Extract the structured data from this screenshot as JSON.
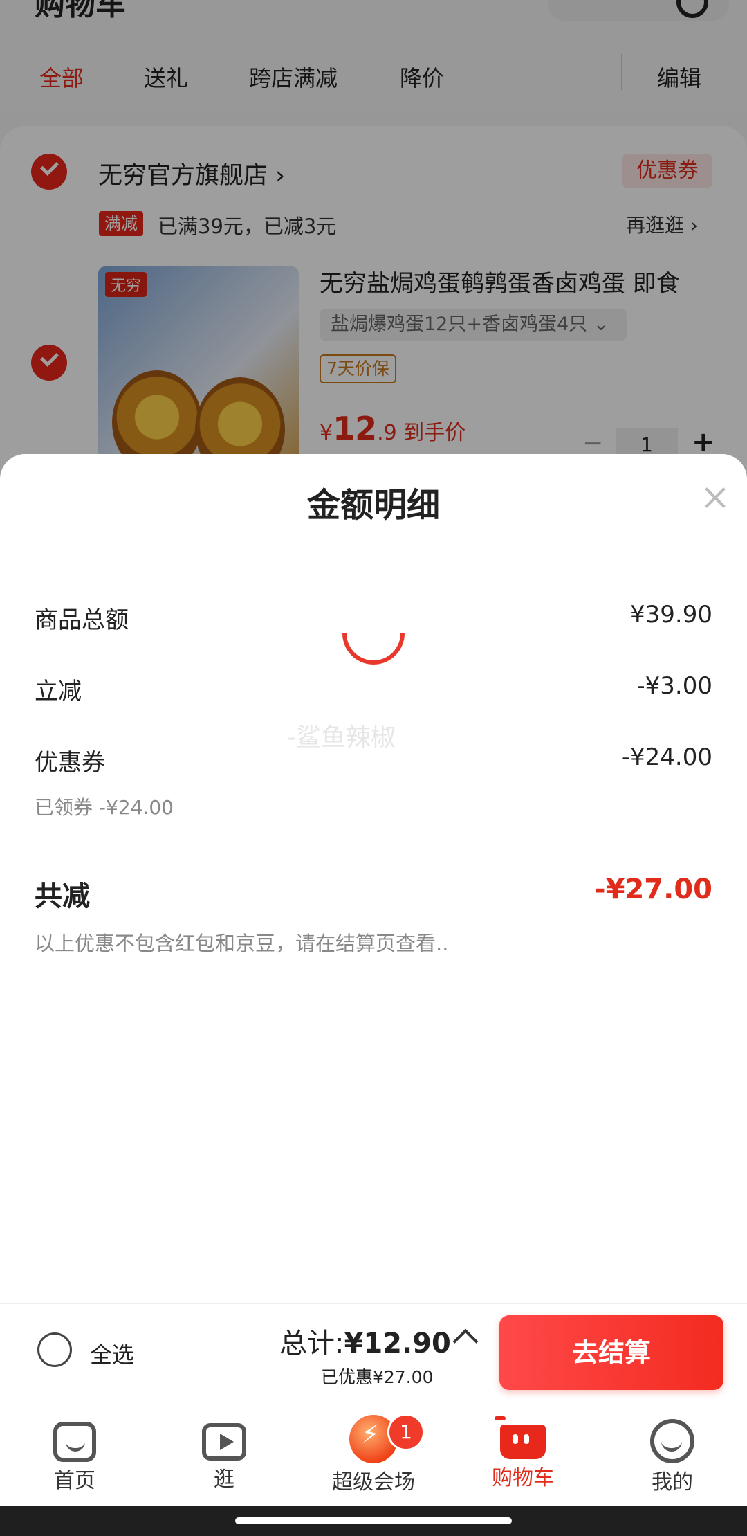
{
  "header": {
    "title": "购物车"
  },
  "tabs": [
    {
      "label": "全部"
    },
    {
      "label": "送礼"
    },
    {
      "label": "跨店满减"
    },
    {
      "label": "降价"
    }
  ],
  "edit_label": "编辑",
  "store": {
    "name": "无穷官方旗舰店 ›",
    "coupon_tag": "优惠券",
    "promo_tag": "满减",
    "promo_text": "已满39元，已减3元",
    "stroll": "再逛逛 ›",
    "brand_logo": "无穷"
  },
  "product": {
    "title": "无穷盐焗鸡蛋鹌鹑蛋香卤鸡蛋 即食",
    "sku": "盐焗爆鸡蛋12只+香卤鸡蛋4只  ⌄",
    "guarantee": "7天价保",
    "price_symbol": "¥",
    "price_int": "12",
    "price_dec": ".9",
    "price_note": "到手价",
    "qty": "1",
    "minus": "−",
    "plus": "+"
  },
  "sheet": {
    "title": "金额明细",
    "rows": [
      {
        "label": "商品总额",
        "value": "¥39.90"
      },
      {
        "label": "立减",
        "value": "-¥3.00"
      },
      {
        "label": "优惠券",
        "value": "-¥24.00"
      }
    ],
    "coupon_sub": "已领券 -¥24.00",
    "total_label": "共减",
    "total_value": "-¥27.00",
    "note": "以上优惠不包含红包和京豆，请在结算页查看..",
    "watermark": "-鲨鱼辣椒"
  },
  "checkout": {
    "select_all": "全选",
    "total_prefix": "总计:",
    "total_value": "¥12.90",
    "saved": "已优惠¥27.00",
    "pay_button": "去结算"
  },
  "nav": [
    {
      "label": "首页",
      "icon": "home-icon"
    },
    {
      "label": "逛",
      "icon": "video-icon"
    },
    {
      "label": "超级会场",
      "icon": "venue-icon"
    },
    {
      "label": "购物车",
      "icon": "cart-icon"
    },
    {
      "label": "我的",
      "icon": "profile-icon"
    }
  ],
  "nav_badge": "1",
  "colors": {
    "accent": "#e12b1b",
    "overlay": "rgba(0,0,0,0.38)"
  }
}
